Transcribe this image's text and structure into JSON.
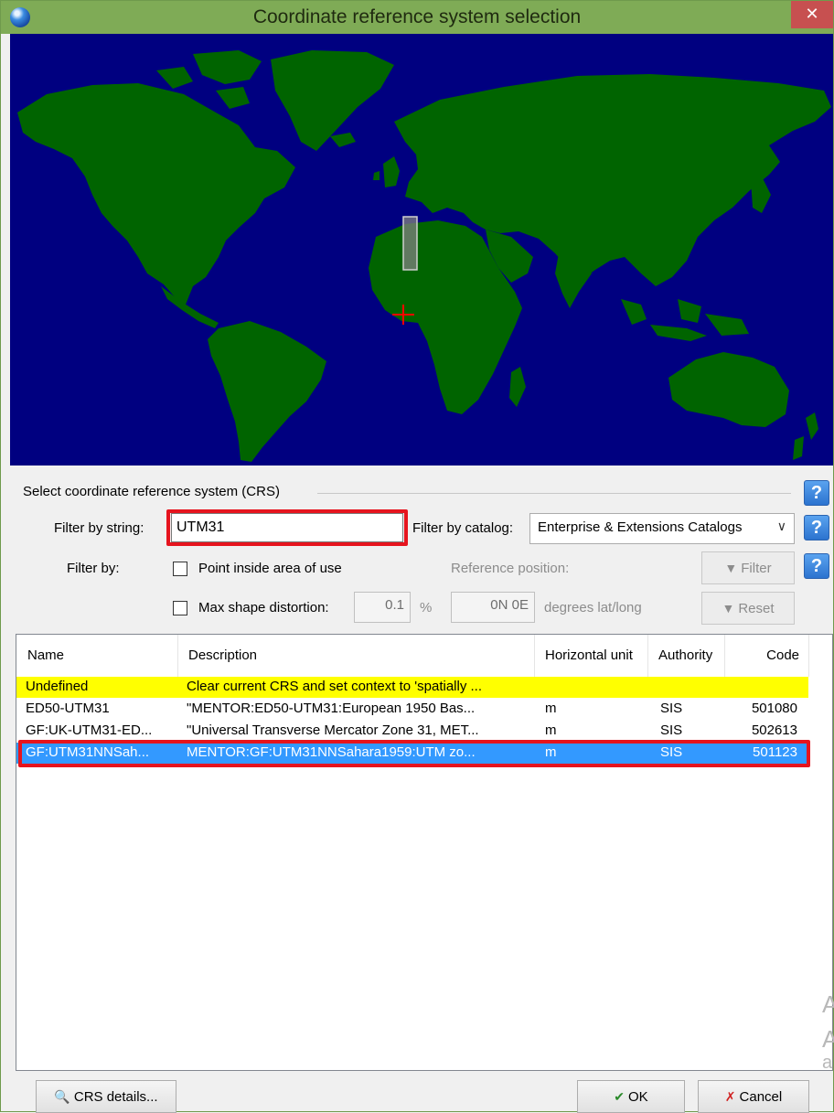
{
  "window": {
    "title": "Coordinate reference system selection",
    "close_glyph": "✕",
    "title_bar_color": "#7fab56"
  },
  "map": {
    "ocean_color": "#000080",
    "land_color": "#006400",
    "marker": "red crosshair near the Gulf of Guinea",
    "area_of_use": "grey rectangle over North-West Africa"
  },
  "crs_group": {
    "label": "Select coordinate reference system (CRS)",
    "help_glyph": "?"
  },
  "filter": {
    "string_label": "Filter by string:",
    "string_value": "UTM31",
    "catalog_label": "Filter by catalog:",
    "catalog_value": "Enterprise & Extensions Catalogs",
    "catalog_arrow": "∨",
    "by_label": "Filter by:",
    "point_inside_label": "Point inside area of use",
    "point_inside_checked": false,
    "reference_position_label": "Reference position:",
    "filter_button": "Filter",
    "max_distortion_label": "Max shape distortion:",
    "max_distortion_checked": false,
    "distortion_value": "0.1",
    "percent_label": "%",
    "position_value": "0N 0E",
    "degrees_label": "degrees lat/long",
    "reset_button": "Reset"
  },
  "table": {
    "headers": [
      "Name",
      "Description",
      "Horizontal unit",
      "Authority",
      "Code"
    ],
    "rows": [
      {
        "name": "Undefined",
        "description": "Clear current CRS and set context to 'spatially ...",
        "unit": "",
        "authority": "",
        "code": "",
        "state": "undefined"
      },
      {
        "name": "ED50-UTM31",
        "description": "\"MENTOR:ED50-UTM31:European 1950 Bas...",
        "unit": "m",
        "authority": "SIS",
        "code": "501080",
        "state": "normal"
      },
      {
        "name": "GF:UK-UTM31-ED...",
        "description": "\"Universal Transverse Mercator Zone 31, MET...",
        "unit": "m",
        "authority": "SIS",
        "code": "502613",
        "state": "normal"
      },
      {
        "name": "GF:UTM31NNSah...",
        "description": "MENTOR:GF:UTM31NNSahara1959:UTM zo...",
        "unit": "m",
        "authority": "SIS",
        "code": "501123",
        "state": "selected"
      }
    ],
    "selection_color": "#3399ff",
    "undefined_row_color": "#ffff00"
  },
  "buttons": {
    "crs_details": "CRS details...",
    "ok": "OK",
    "cancel": "Cancel"
  },
  "icons": {
    "window_icon": "globe-icon",
    "filter_icon": "funnel-icon",
    "reset_icon": "funnel-clear-icon",
    "details_icon": "document-magnifier-icon",
    "ok_icon": "check-icon",
    "cancel_icon": "x-icon"
  },
  "watermark": [
    "A",
    "A",
    "a"
  ],
  "highlight_color": "#e6141e"
}
